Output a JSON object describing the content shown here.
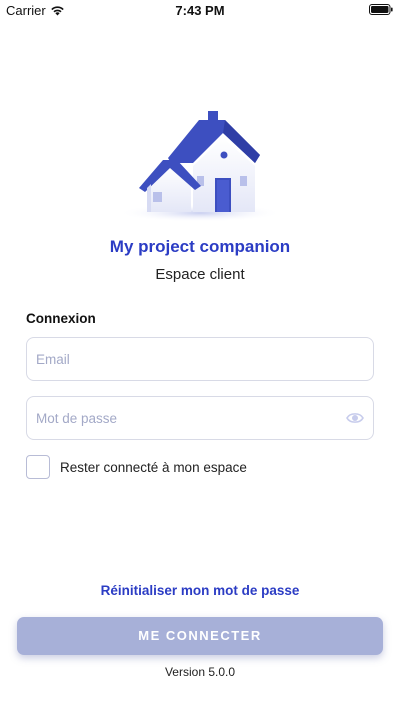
{
  "status_bar": {
    "carrier": "Carrier",
    "time": "7:43 PM",
    "icons": [
      "wifi-icon",
      "battery-icon"
    ]
  },
  "branding": {
    "illustration": "house-icon",
    "title": "My project companion",
    "subtitle": "Espace client"
  },
  "login_form": {
    "section_label": "Connexion",
    "email_placeholder": "Email",
    "email_value": "",
    "password_placeholder": "Mot de passe",
    "password_value": "",
    "password_toggle_icon": "eye-icon",
    "remember_label": "Rester connecté à mon espace",
    "remember_checked": false
  },
  "actions": {
    "reset_password": "Réinitialiser mon mot de passe",
    "login_button": "ME CONNECTER"
  },
  "footer": {
    "version": "Version 5.0.0"
  },
  "colors": {
    "accent": "#2b3cc4",
    "button_disabled": "#a7b0d8",
    "input_border": "#d8dae6",
    "placeholder": "#a3a9c7"
  }
}
